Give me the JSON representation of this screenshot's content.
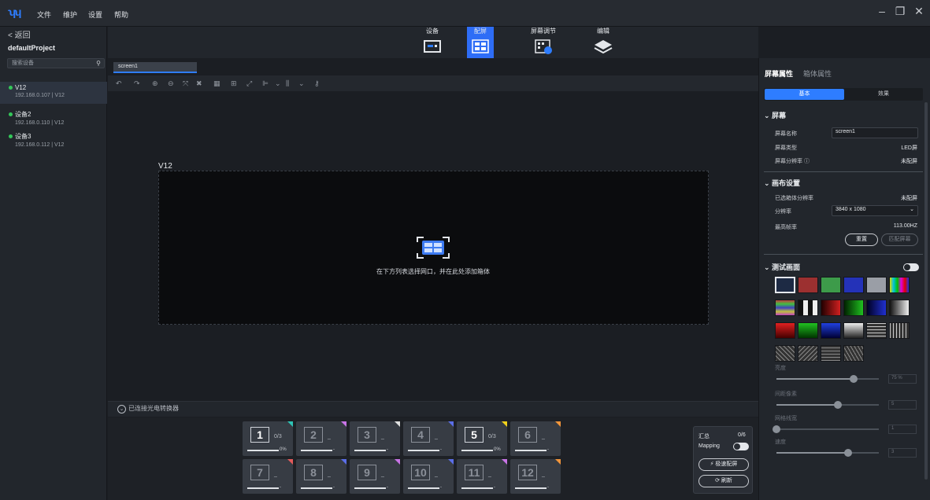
{
  "menu": {
    "items": [
      "文件",
      "维护",
      "设置",
      "帮助"
    ]
  },
  "window_controls": {
    "min": "–",
    "restore": "❐",
    "close": "✕"
  },
  "sidebar": {
    "back_label": "< 返回",
    "project_name": "defaultProject",
    "search_placeholder": "搜索设备",
    "devices": [
      {
        "name": "V12",
        "ip": "192.168.0.107 | V12",
        "selected": true
      },
      {
        "name": "设备2",
        "ip": "192.168.0.110 | V12",
        "selected": false
      },
      {
        "name": "设备3",
        "ip": "192.168.0.112 | V12",
        "selected": false
      }
    ]
  },
  "toolbar": {
    "items": [
      {
        "label": "设备",
        "icon": "device-icon",
        "active": false
      },
      {
        "label": "配屏",
        "icon": "screen-config-icon",
        "active": true
      },
      {
        "label": "屏幕调节",
        "icon": "screen-adjust-icon",
        "active": false
      },
      {
        "label": "编辑",
        "icon": "layers-icon",
        "active": false
      }
    ]
  },
  "canvas": {
    "tab_label": "screen1",
    "screen_label": "V12",
    "hint": "在下方列表选择网口，并在此处添加箱体"
  },
  "bottom": {
    "hint": "已连接光电转换器",
    "ports": [
      {
        "num": "1",
        "count": "0/3",
        "pct": "0%",
        "on": true,
        "color": "#2ec4b6"
      },
      {
        "num": "2",
        "count": "_",
        "pct": "-",
        "on": false,
        "color": "#c874e6"
      },
      {
        "num": "3",
        "count": "_",
        "pct": "-",
        "on": false,
        "color": "#e0e0e0"
      },
      {
        "num": "4",
        "count": "_",
        "pct": "-",
        "on": false,
        "color": "#5b6ee8"
      },
      {
        "num": "5",
        "count": "0/3",
        "pct": "0%",
        "on": true,
        "color": "#f2d21b"
      },
      {
        "num": "6",
        "count": "_",
        "pct": "-",
        "on": false,
        "color": "#f2953b"
      },
      {
        "num": "7",
        "count": "_",
        "pct": "-",
        "on": false,
        "color": "#e45b5b"
      },
      {
        "num": "8",
        "count": "_",
        "pct": "-",
        "on": false,
        "color": "#5b6ee8"
      },
      {
        "num": "9",
        "count": "_",
        "pct": "-",
        "on": false,
        "color": "#c874e6"
      },
      {
        "num": "10",
        "count": "_",
        "pct": "-",
        "on": false,
        "color": "#5b6ee8"
      },
      {
        "num": "11",
        "count": "_",
        "pct": "-",
        "on": false,
        "color": "#c874e6"
      },
      {
        "num": "12",
        "count": "_",
        "pct": "-",
        "on": false,
        "color": "#f2953b"
      }
    ],
    "summary": {
      "total_label": "汇总",
      "total_value": "0/6",
      "mapping_label": "Mapping",
      "fast_button": "⚡ 极速配屏",
      "refresh_button": "⟳ 刷新"
    }
  },
  "right_panel": {
    "tabs": [
      "屏幕属性",
      "箱体属性"
    ],
    "segments": [
      "基本",
      "效果"
    ],
    "screen_section": "屏幕",
    "screen_name_label": "屏幕名称",
    "screen_name_value": "screen1",
    "screen_type_label": "屏幕类型",
    "screen_type_value": "LED屏",
    "screen_res_label": "屏幕分辨率 ⓘ",
    "screen_res_value": "未配屏",
    "canvas_section": "画布设置",
    "box_res_label": "已选箱体分辨率",
    "box_res_value": "未配屏",
    "res_label": "分辨率",
    "res_value": "3840 x 1080",
    "fps_label": "最高帧率",
    "fps_value": "113.00HZ",
    "reset_button": "重置",
    "match_button": "匹配屏幕",
    "test_section": "测试画面",
    "sliders": [
      {
        "label": "亮度",
        "value": "75 %",
        "level": 0.75
      },
      {
        "label": "间距像素",
        "value": "5",
        "level": 0.6
      },
      {
        "label": "网格线宽",
        "value": "1",
        "level": 0.0
      },
      {
        "label": "速度",
        "value": "3",
        "level": 0.7
      }
    ]
  },
  "colors": {
    "accent": "#2e6df6",
    "bg": "#1b1e23",
    "panel": "#22262c"
  }
}
